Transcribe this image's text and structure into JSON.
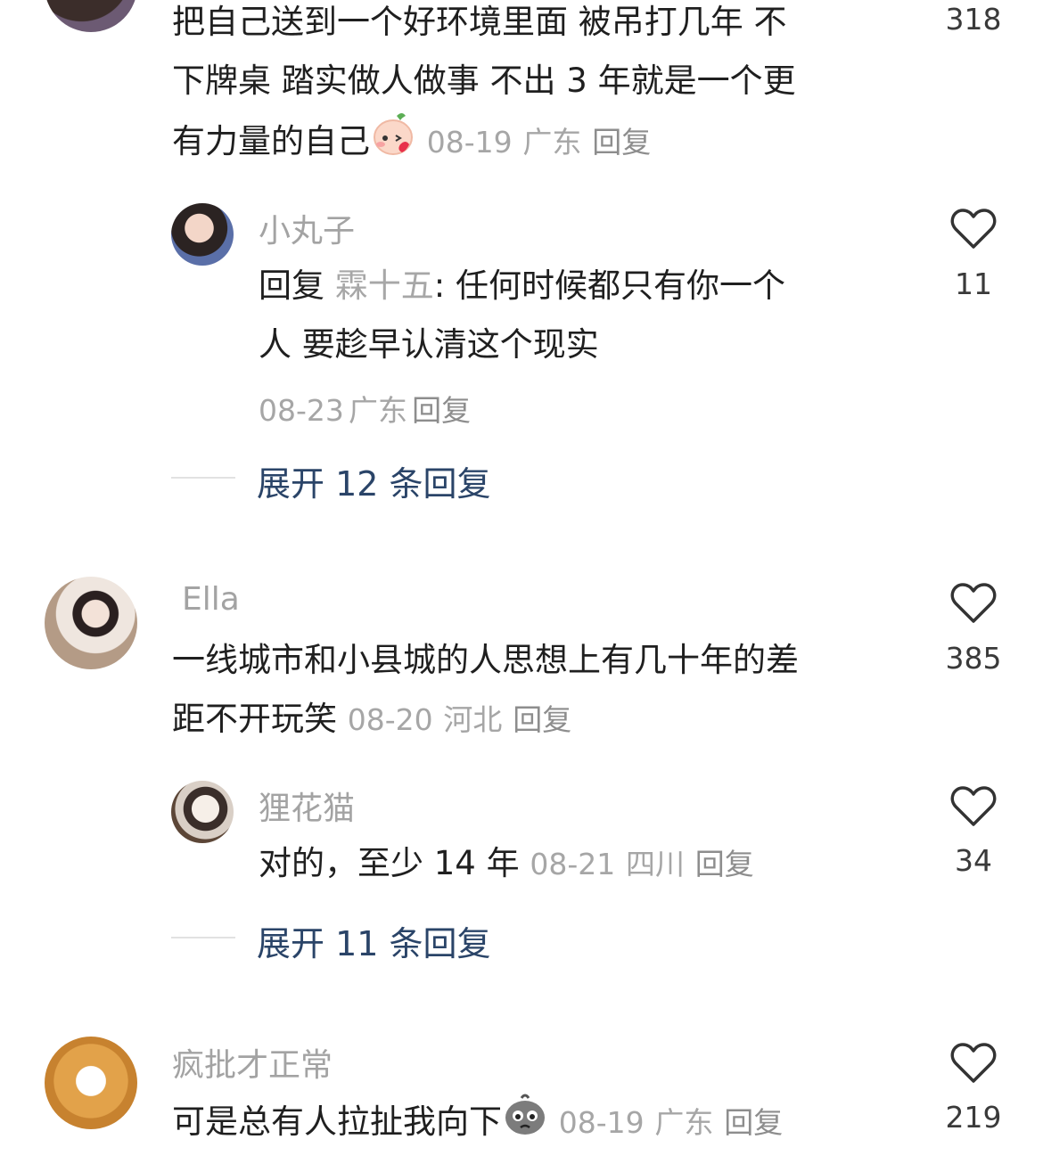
{
  "comments": [
    {
      "text_lines": [
        "把自己送到一个好环境里面 被吊打几年 不",
        "下牌桌 踏实做人做事 不出 3 年就是一个更",
        "有力量的自己"
      ],
      "date": "08-19",
      "location": "广东",
      "reply_label": "回复",
      "likes": "318",
      "sub_reply": {
        "author": "小丸子",
        "prefix": "回复",
        "target": "霖十五",
        "text_lines": [
          ": 任何时候都只有你一个",
          "人 要趁早认清这个现实"
        ],
        "date": "08-23",
        "location": "广东",
        "reply_label": "回复",
        "likes": "11"
      },
      "expand_label": "展开 12 条回复"
    },
    {
      "author": "Ella",
      "text_lines": [
        "一线城市和小县城的人思想上有几十年的差",
        "距不开玩笑"
      ],
      "date": "08-20",
      "location": "河北",
      "reply_label": "回复",
      "likes": "385",
      "sub_reply": {
        "author": "狸花猫",
        "text": "对的，至少 14 年",
        "date": "08-21",
        "location": "四川",
        "reply_label": "回复",
        "likes": "34"
      },
      "expand_label": "展开 11 条回复"
    },
    {
      "author": "疯批才正常",
      "text": "可是总有人拉扯我向下",
      "date": "08-19",
      "location": "广东",
      "reply_label": "回复",
      "likes": "219"
    }
  ],
  "icons": {
    "like": "heart-outline-icon",
    "emoji1": "blushing-peach-emoji-icon",
    "emoji2": "sad-gray-face-emoji-icon"
  }
}
